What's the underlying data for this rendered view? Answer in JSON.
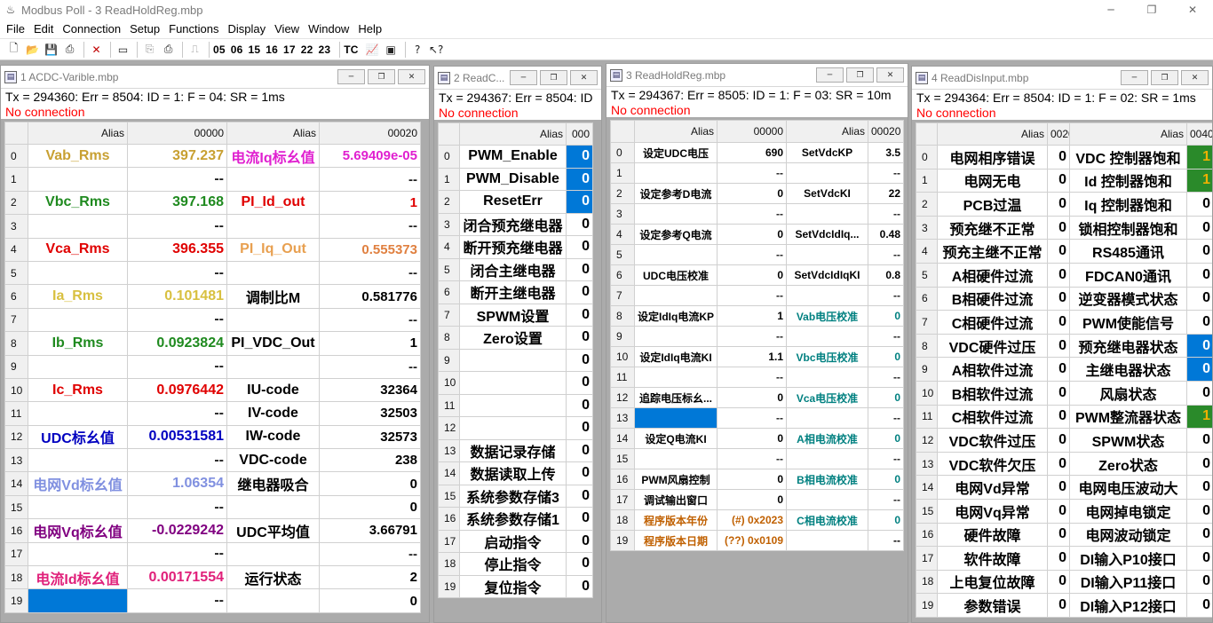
{
  "app": {
    "title": "Modbus Poll - 3 ReadHoldReg.mbp",
    "window_controls": [
      "─",
      "❐",
      "✕"
    ]
  },
  "menu": [
    "File",
    "Edit",
    "Connection",
    "Setup",
    "Functions",
    "Display",
    "View",
    "Window",
    "Help"
  ],
  "toolbar": {
    "function_codes": [
      "05",
      "06",
      "15",
      "16",
      "17",
      "22",
      "23"
    ],
    "tc_label": "TC"
  },
  "child_buttons": [
    "─",
    "❐",
    "✕"
  ],
  "colors": {
    "selection": "#0078d7",
    "no_connection": "#ff0000",
    "sel_green": "#2a8a2a",
    "sel_orange": "#e8a000"
  },
  "windows": [
    {
      "title": "1 ACDC-Varible.mbp",
      "status": "Tx = 294360: Err = 8504: ID = 1: F = 04: SR = 1ms",
      "connection": "No connection",
      "headers": [
        "",
        "Alias",
        "00000",
        "Alias",
        "00020"
      ],
      "rows": [
        [
          "0",
          "Vab_Rms",
          "397.237",
          "电流Iq标幺值",
          "5.69409e-05"
        ],
        [
          "1",
          "",
          "--",
          "",
          "--"
        ],
        [
          "2",
          "Vbc_Rms",
          "397.168",
          "PI_Id_out",
          "1"
        ],
        [
          "3",
          "",
          "--",
          "",
          "--"
        ],
        [
          "4",
          "Vca_Rms",
          "396.355",
          "PI_Iq_Out",
          "0.555373"
        ],
        [
          "5",
          "",
          "--",
          "",
          "--"
        ],
        [
          "6",
          "Ia_Rms",
          "0.101481",
          "调制比M",
          "0.581776"
        ],
        [
          "7",
          "",
          "--",
          "",
          "--"
        ],
        [
          "8",
          "Ib_Rms",
          "0.0923824",
          "PI_VDC_Out",
          "1"
        ],
        [
          "9",
          "",
          "--",
          "",
          "--"
        ],
        [
          "10",
          "Ic_Rms",
          "0.0976442",
          "IU-code",
          "32364"
        ],
        [
          "11",
          "",
          "--",
          "IV-code",
          "32503"
        ],
        [
          "12",
          "UDC标幺值",
          "0.00531581",
          "IW-code",
          "32573"
        ],
        [
          "13",
          "",
          "--",
          "VDC-code",
          "238"
        ],
        [
          "14",
          "电网Vd标幺值",
          "1.06354",
          "继电器吸合",
          "0"
        ],
        [
          "15",
          "",
          "--",
          "",
          "0"
        ],
        [
          "16",
          "电网Vq标幺值",
          "-0.0229242",
          "UDC平均值",
          "3.66791"
        ],
        [
          "17",
          "",
          "--",
          "",
          "--"
        ],
        [
          "18",
          "电流Id标幺值",
          "0.00171554",
          "运行状态",
          "2"
        ],
        [
          "19",
          "",
          "--",
          "",
          "0"
        ]
      ],
      "colors": {
        "0": [
          "#c8a032",
          "#c8a032",
          "#e020d0",
          "#e020d0"
        ],
        "2": [
          "#1f8a1f",
          "#1f8a1f",
          "#e00000",
          "#e00000"
        ],
        "4": [
          "#e00000",
          "#e00000",
          "#e8a050",
          "#e08040"
        ],
        "6": [
          "#d8c040",
          "#d8c040",
          "#000000",
          "#000000"
        ],
        "8": [
          "#1f8a1f",
          "#1f8a1f",
          "#000000",
          "#000000"
        ],
        "10": [
          "#e00000",
          "#e00000",
          "#000000",
          "#000000"
        ],
        "12": [
          "#0000c0",
          "#0000c0",
          "#000000",
          "#000000"
        ],
        "14": [
          "#8090e0",
          "#8090e0",
          "#000000",
          "#000000"
        ],
        "16": [
          "#800080",
          "#800080",
          "#000000",
          "#000000"
        ],
        "18": [
          "#e0207a",
          "#e0207a",
          "#000000",
          "#000000"
        ]
      },
      "selected": [
        [
          19,
          1
        ]
      ]
    },
    {
      "title": "2 ReadC...",
      "status": "Tx = 294367: Err = 8504: ID",
      "connection": "No connection",
      "headers": [
        "",
        "Alias",
        "000"
      ],
      "rows": [
        [
          "0",
          "PWM_Enable",
          "0"
        ],
        [
          "1",
          "PWM_Disable",
          "0"
        ],
        [
          "2",
          "ResetErr",
          "0"
        ],
        [
          "3",
          "闭合预充继电器",
          "0"
        ],
        [
          "4",
          "断开预充继电器",
          "0"
        ],
        [
          "5",
          "闭合主继电器",
          "0"
        ],
        [
          "6",
          "断开主继电器",
          "0"
        ],
        [
          "7",
          "SPWM设置",
          "0"
        ],
        [
          "8",
          "Zero设置",
          "0"
        ],
        [
          "9",
          "",
          "0"
        ],
        [
          "10",
          "",
          "0"
        ],
        [
          "11",
          "",
          "0"
        ],
        [
          "12",
          "",
          "0"
        ],
        [
          "13",
          "数据记录存储",
          "0"
        ],
        [
          "14",
          "数据读取上传",
          "0"
        ],
        [
          "15",
          "系统参数存储3",
          "0"
        ],
        [
          "16",
          "系统参数存储1",
          "0"
        ],
        [
          "17",
          "启动指令",
          "0"
        ],
        [
          "18",
          "停止指令",
          "0"
        ],
        [
          "19",
          "复位指令",
          "0"
        ]
      ],
      "selected": [
        [
          0,
          2
        ],
        [
          1,
          2
        ],
        [
          2,
          2
        ]
      ]
    },
    {
      "title": "3 ReadHoldReg.mbp",
      "status": "Tx = 294367: Err = 8505: ID = 1: F = 03: SR = 10m",
      "connection": "No connection",
      "headers": [
        "",
        "Alias",
        "00000",
        "Alias",
        "00020"
      ],
      "rows": [
        [
          "0",
          "设定UDC电压",
          "690",
          "SetVdcKP",
          "3.5"
        ],
        [
          "1",
          "",
          "--",
          "",
          "--"
        ],
        [
          "2",
          "设定参考D电流",
          "0",
          "SetVdcKI",
          "22"
        ],
        [
          "3",
          "",
          "--",
          "",
          "--"
        ],
        [
          "4",
          "设定参考Q电流",
          "0",
          "SetVdcIdIq...",
          "0.48"
        ],
        [
          "5",
          "",
          "--",
          "",
          "--"
        ],
        [
          "6",
          "UDC电压校准",
          "0",
          "SetVdcIdIqKI",
          "0.8"
        ],
        [
          "7",
          "",
          "--",
          "",
          "--"
        ],
        [
          "8",
          "设定IdIq电流KP",
          "1",
          "Vab电压校准",
          "0"
        ],
        [
          "9",
          "",
          "--",
          "",
          "--"
        ],
        [
          "10",
          "设定IdIq电流KI",
          "1.1",
          "Vbc电压校准",
          "0"
        ],
        [
          "11",
          "",
          "--",
          "",
          "--"
        ],
        [
          "12",
          "追踪电压标幺...",
          "0",
          "Vca电压校准",
          "0"
        ],
        [
          "13",
          "",
          "--",
          "",
          "--"
        ],
        [
          "14",
          "设定Q电流KI",
          "0",
          "A相电流校准",
          "0"
        ],
        [
          "15",
          "",
          "--",
          "",
          "--"
        ],
        [
          "16",
          "PWM风扇控制",
          "0",
          "B相电流校准",
          "0"
        ],
        [
          "17",
          "调试输出窗口",
          "0",
          "",
          "--"
        ],
        [
          "18",
          "程序版本年份",
          "(#) 0x2023",
          "C相电流校准",
          "0"
        ],
        [
          "19",
          "程序版本日期",
          "(??) 0x0109",
          "",
          "--"
        ]
      ],
      "colors": {
        "8": [
          "#000000",
          "#000000",
          "#008080",
          "#008080"
        ],
        "10": [
          "#000000",
          "#000000",
          "#008080",
          "#008080"
        ],
        "12": [
          "#000000",
          "#000000",
          "#008080",
          "#008080"
        ],
        "14": [
          "#000000",
          "#000000",
          "#008080",
          "#008080"
        ],
        "16": [
          "#000000",
          "#000000",
          "#008080",
          "#008080"
        ],
        "18": [
          "#c06000",
          "#c06000",
          "#008080",
          "#008080"
        ],
        "19": [
          "#c06000",
          "#c06000",
          "#000000",
          "#000000"
        ]
      },
      "selected": [
        [
          13,
          1
        ]
      ]
    },
    {
      "title": "4 ReadDisInput.mbp",
      "status": "Tx = 294364: Err = 8504: ID = 1: F = 02: SR = 1ms",
      "connection": "No connection",
      "headers": [
        "",
        "Alias",
        "0020",
        "Alias",
        "0040"
      ],
      "rows": [
        [
          "0",
          "电网相序错误",
          "0",
          "VDC 控制器饱和",
          "1"
        ],
        [
          "1",
          "电网无电",
          "0",
          "Id 控制器饱和",
          "1"
        ],
        [
          "2",
          "PCB过温",
          "0",
          "Iq 控制器饱和",
          "0"
        ],
        [
          "3",
          "预充继不正常",
          "0",
          "锁相控制器饱和",
          "0"
        ],
        [
          "4",
          "预充主继不正常",
          "0",
          "RS485通讯",
          "0"
        ],
        [
          "5",
          "A相硬件过流",
          "0",
          "FDCAN0通讯",
          "0"
        ],
        [
          "6",
          "B相硬件过流",
          "0",
          "逆变器模式状态",
          "0"
        ],
        [
          "7",
          "C相硬件过流",
          "0",
          "PWM使能信号",
          "0"
        ],
        [
          "8",
          "VDC硬件过压",
          "0",
          "预充继电器状态",
          "0"
        ],
        [
          "9",
          "A相软件过流",
          "0",
          "主继电器状态",
          "0"
        ],
        [
          "10",
          "B相软件过流",
          "0",
          "风扇状态",
          "0"
        ],
        [
          "11",
          "C相软件过流",
          "0",
          "PWM整流器状态",
          "1"
        ],
        [
          "12",
          "VDC软件过压",
          "0",
          "SPWM状态",
          "0"
        ],
        [
          "13",
          "VDC软件欠压",
          "0",
          "Zero状态",
          "0"
        ],
        [
          "14",
          "电网Vd异常",
          "0",
          "电网电压波动大",
          "0"
        ],
        [
          "15",
          "电网Vq异常",
          "0",
          "电网掉电锁定",
          "0"
        ],
        [
          "16",
          "硬件故障",
          "0",
          "电网波动锁定",
          "0"
        ],
        [
          "17",
          "软件故障",
          "0",
          "DI输入P10接口",
          "0"
        ],
        [
          "18",
          "上电复位故障",
          "0",
          "DI输入P11接口",
          "0"
        ],
        [
          "19",
          "参数错误",
          "0",
          "DI输入P12接口",
          "0"
        ]
      ],
      "cell_fill": {
        "0": "green",
        "1": "green",
        "8": "blue",
        "9": "blue",
        "11": "green"
      }
    }
  ]
}
